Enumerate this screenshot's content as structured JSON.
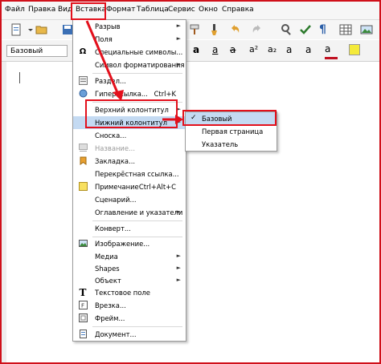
{
  "menubar": {
    "items": [
      {
        "label": "Файл"
      },
      {
        "label": "Правка"
      },
      {
        "label": "Вид"
      },
      {
        "label": "Вставка"
      },
      {
        "label": "Формат"
      },
      {
        "label": "Таблица"
      },
      {
        "label": "Сервис"
      },
      {
        "label": "Окно"
      },
      {
        "label": "Справка"
      }
    ]
  },
  "formatting": {
    "paragraph_style": "Базовый"
  },
  "insert_menu": {
    "items": [
      {
        "label": "Разрыв",
        "arrow": "►"
      },
      {
        "label": "Поля",
        "arrow": "►"
      },
      {
        "label": "Специальные символы..."
      },
      {
        "label": "Символ форматирования",
        "arrow": "►"
      },
      {
        "label": "Раздел..."
      },
      {
        "label": "Гиперссылка...",
        "shortcut": "Ctrl+K"
      },
      {
        "label": "Верхний колонтитул",
        "arrow": "►"
      },
      {
        "label": "Нижний колонтитул",
        "arrow": "►"
      },
      {
        "label": "Сноска..."
      },
      {
        "label": "Название..."
      },
      {
        "label": "Закладка..."
      },
      {
        "label": "Перекрёстная ссылка..."
      },
      {
        "label": "Примечание",
        "shortcut": "Ctrl+Alt+C"
      },
      {
        "label": "Сценарий..."
      },
      {
        "label": "Оглавление и указатели",
        "arrow": "►"
      },
      {
        "label": "Конверт..."
      },
      {
        "label": "Изображение..."
      },
      {
        "label": "Медиа",
        "arrow": "►"
      },
      {
        "label": "Shapes",
        "arrow": "►"
      },
      {
        "label": "Объект",
        "arrow": "►"
      },
      {
        "label": "Текстовое поле"
      },
      {
        "label": "Врезка..."
      },
      {
        "label": "Фрейм..."
      },
      {
        "label": "Документ..."
      }
    ]
  },
  "footer_submenu": {
    "check": "✓",
    "items": [
      {
        "label": "Базовый"
      },
      {
        "label": "Первая страница"
      },
      {
        "label": "Указатель"
      }
    ]
  },
  "colors": {
    "highlight_red": "#e3101c",
    "menu_hover": "#c4daf2"
  }
}
